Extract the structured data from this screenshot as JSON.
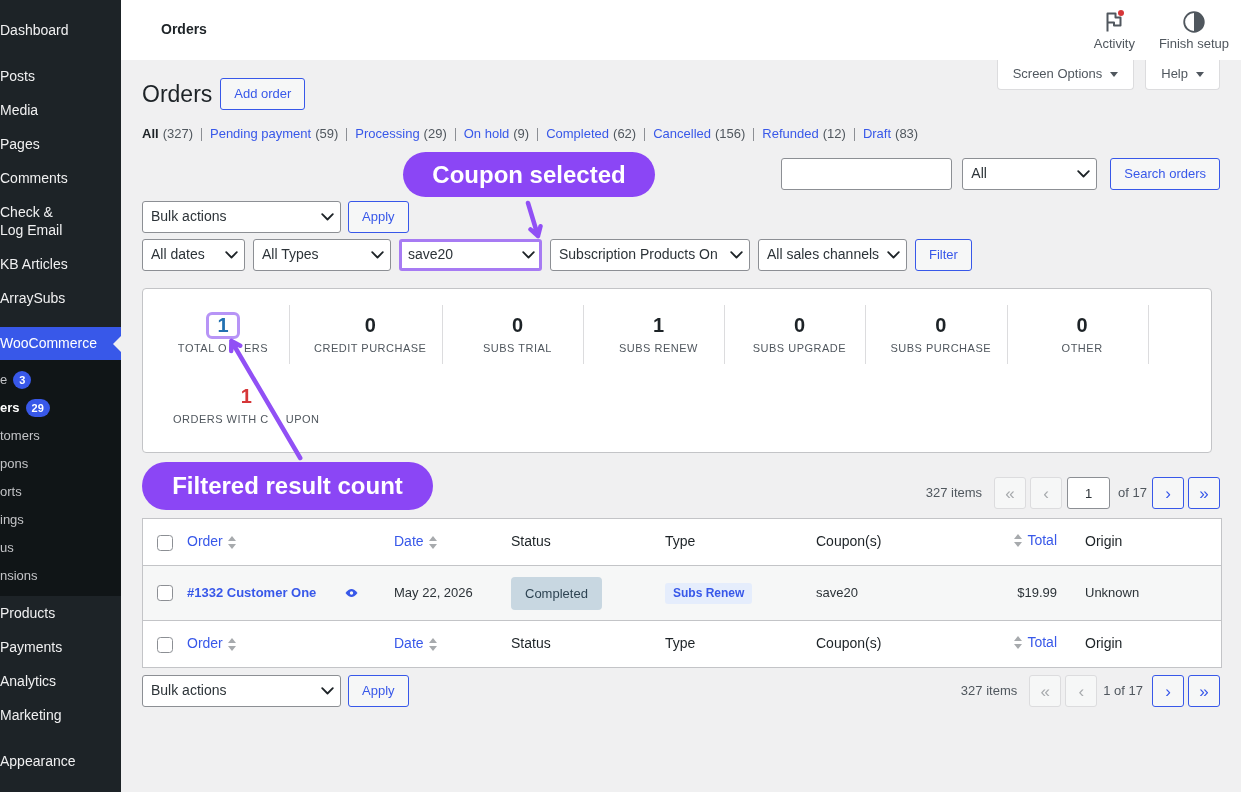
{
  "sidebar": {
    "groups": [
      {
        "items": [
          {
            "label": "Dashboard",
            "selected": false
          }
        ]
      },
      {
        "items": [
          {
            "label": "Posts",
            "selected": false
          },
          {
            "label": "Media",
            "selected": false
          },
          {
            "label": "Pages",
            "selected": false
          },
          {
            "label": "Comments",
            "selected": false
          },
          {
            "label": "Check &\nLog Email",
            "selected": false
          },
          {
            "label": "KB Articles",
            "selected": false
          },
          {
            "label": "ArraySubs",
            "selected": false
          }
        ]
      },
      {
        "items": [
          {
            "label": "WooCommerce",
            "selected": true,
            "children": [
              {
                "label": "e",
                "badge": "3",
                "selected": false
              },
              {
                "label": "ers",
                "badge": "29",
                "selected": true
              },
              {
                "label": "tomers",
                "selected": false
              },
              {
                "label": "pons",
                "selected": false
              },
              {
                "label": "orts",
                "selected": false
              },
              {
                "label": "ings",
                "selected": false
              },
              {
                "label": "us",
                "selected": false
              },
              {
                "label": "nsions",
                "selected": false
              }
            ]
          },
          {
            "label": "Products",
            "selected": false
          },
          {
            "label": "Payments",
            "selected": false
          },
          {
            "label": "Analytics",
            "selected": false
          },
          {
            "label": "Marketing",
            "selected": false
          }
        ]
      },
      {
        "items": [
          {
            "label": "Appearance",
            "selected": false
          }
        ]
      }
    ]
  },
  "top_bar": {
    "title": "Orders",
    "actions": [
      {
        "label": "Activity",
        "kind": "activity",
        "notification": true
      },
      {
        "label": "Finish setup",
        "kind": "setup",
        "notification": false
      }
    ]
  },
  "screen_tabs": [
    {
      "label": "Screen Options"
    },
    {
      "label": "Help"
    }
  ],
  "heading": {
    "title": "Orders",
    "button": "Add order"
  },
  "status_filters": [
    {
      "label": "All",
      "count": "(327)",
      "selected": true
    },
    {
      "label": "Pending payment",
      "count": "(59)",
      "selected": false
    },
    {
      "label": "Processing",
      "count": "(29)",
      "selected": false
    },
    {
      "label": "On hold",
      "count": "(9)",
      "selected": false
    },
    {
      "label": "Completed",
      "count": "(62)",
      "selected": false
    },
    {
      "label": "Cancelled",
      "count": "(156)",
      "selected": false
    },
    {
      "label": "Refunded",
      "count": "(12)",
      "selected": false
    },
    {
      "label": "Draft",
      "count": "(83)",
      "selected": false
    }
  ],
  "search": {
    "scope": "All",
    "button": "Search orders"
  },
  "bulk_actions_top": {
    "select": "Bulk actions",
    "button": "Apply"
  },
  "filters": {
    "selects": [
      {
        "value": "All dates",
        "highlighted": false
      },
      {
        "value": "All Types",
        "highlighted": false
      },
      {
        "value": "save20",
        "highlighted": true
      },
      {
        "value": "Subscription Products On",
        "highlighted": false
      },
      {
        "value": "All sales channels",
        "highlighted": false
      }
    ],
    "button": "Filter"
  },
  "stats": [
    {
      "value": "1",
      "label": [
        "TOTAL O",
        "ERS"
      ],
      "color": "#2271b1",
      "highlighted": true
    },
    {
      "value": "0",
      "label": [
        "CREDIT PURCHASE"
      ],
      "color": "#1d2327",
      "highlighted": false
    },
    {
      "value": "0",
      "label": [
        "SUBS TRIAL"
      ],
      "color": "#1d2327",
      "highlighted": false
    },
    {
      "value": "1",
      "label": [
        "SUBS RENEW"
      ],
      "color": "#1d2327",
      "highlighted": false
    },
    {
      "value": "0",
      "label": [
        "SUBS UPGRADE"
      ],
      "color": "#1d2327",
      "highlighted": false
    },
    {
      "value": "0",
      "label": [
        "SUBS PURCHASE"
      ],
      "color": "#1d2327",
      "highlighted": false
    },
    {
      "value": "0",
      "label": [
        "OTHER"
      ],
      "color": "#1d2327",
      "highlighted": false
    },
    {
      "value": "1",
      "label": [
        "ORDERS WITH C",
        "UPON"
      ],
      "color": "#d63638",
      "highlighted": false
    }
  ],
  "annotations": [
    {
      "text": "Coupon selected"
    },
    {
      "text": "Filtered result count"
    }
  ],
  "pagination_top": {
    "count": "327 items",
    "page": "1",
    "total": "of 17",
    "buttons": [
      {
        "label": "«",
        "disabled": true
      },
      {
        "label": "‹",
        "disabled": true
      },
      {
        "label": "›",
        "disabled": false
      },
      {
        "label": "»",
        "disabled": false
      }
    ]
  },
  "table": {
    "header_checked": false,
    "columns": [
      {
        "label": "Order",
        "kind": "sortable"
      },
      {
        "label": "Date",
        "kind": "sortable"
      },
      {
        "label": "Status",
        "kind": "plain"
      },
      {
        "label": "Type",
        "kind": "plain"
      },
      {
        "label": "Coupon(s)",
        "kind": "plain"
      },
      {
        "label": "Total",
        "kind": "sortable-right"
      },
      {
        "label": "Origin",
        "kind": "plain"
      }
    ],
    "rows": [
      {
        "checked": false,
        "order": "#1332 Customer One",
        "date": "May 22, 2026",
        "status": "Completed",
        "type": "Subs Renew",
        "coupons": "save20",
        "total": "$19.99",
        "origin": "Unknown"
      }
    ],
    "footer_checked": false,
    "footer_columns": [
      {
        "label": "Order",
        "kind": "sortable"
      },
      {
        "label": "Date",
        "kind": "sortable"
      },
      {
        "label": "Status",
        "kind": "plain"
      },
      {
        "label": "Type",
        "kind": "plain"
      },
      {
        "label": "Coupon(s)",
        "kind": "plain"
      },
      {
        "label": "Total",
        "kind": "sortable-right"
      },
      {
        "label": "Origin",
        "kind": "plain"
      }
    ]
  },
  "bulk_actions_bottom": {
    "select": "Bulk actions",
    "button": "Apply"
  },
  "pagination_bottom": {
    "count": "327 items",
    "page": "1 of 17",
    "buttons": [
      {
        "label": "«",
        "disabled": true
      },
      {
        "label": "‹",
        "disabled": true
      },
      {
        "label": "›",
        "disabled": false
      },
      {
        "label": "»",
        "disabled": false
      }
    ]
  }
}
